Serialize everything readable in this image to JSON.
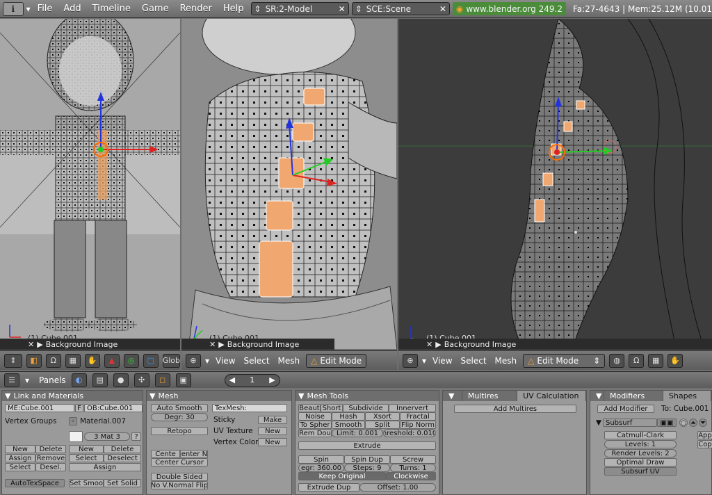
{
  "topbar": {
    "menus": [
      "File",
      "Add",
      "Timeline",
      "Game",
      "Render",
      "Help"
    ],
    "screen": "SR:2-Model",
    "scene": "SCE:Scene",
    "version_link": "www.blender.org 249.2",
    "stats": "Fa:27-4643 | Mem:25.12M (10.01"
  },
  "viewports": {
    "left": {
      "object_label": "(1) Cube.001",
      "bg_label": "Background Image"
    },
    "middle": {
      "object_label": "(1) Cube.001",
      "bg_label": "Background Image"
    },
    "right": {
      "object_label": "(1) Cube.001",
      "bg_label": "Background Image"
    }
  },
  "headers": {
    "left": {
      "glob": "Glob"
    },
    "middle": {
      "menus": [
        "View",
        "Select",
        "Mesh"
      ],
      "mode": "Edit Mode"
    },
    "right": {
      "menus": [
        "View",
        "Select",
        "Mesh"
      ],
      "mode": "Edit Mode"
    }
  },
  "buttons_window": {
    "label": "Panels",
    "page": "1"
  },
  "link_materials": {
    "title": "Link and Materials",
    "me_field": "ME:Cube.001",
    "f_label": "F",
    "ob_field": "OB:Cube.001",
    "vertex_groups": "Vertex Groups",
    "material_name": "Material.007",
    "mat_index": "3 Mat 3",
    "q": "?",
    "vg_buttons": {
      "new": "New",
      "delete": "Delete",
      "assign": "Assign",
      "remove": "Remove",
      "select": "Select",
      "desel": "Desel."
    },
    "mat_buttons": {
      "new": "New",
      "delete": "Delete",
      "select": "Select",
      "deselect": "Deselect",
      "assign": "Assign"
    },
    "autotexspace": "AutoTexSpace",
    "set_smooth": "Set Smoo",
    "set_solid": "Set Solid"
  },
  "mesh": {
    "title": "Mesh",
    "auto_smooth": "Auto Smooth",
    "degr": "Degr: 30",
    "retopo": "Retopo",
    "texmesh": "TexMesh:",
    "sticky": "Sticky",
    "make": "Make",
    "uv_texture": "UV Texture",
    "new1": "New",
    "vertex_color": "Vertex Color",
    "new2": "New",
    "center": "Cente",
    "center_new": "Center Ne",
    "center_cursor": "Center Cursor",
    "double_sided": "Double Sided",
    "no_vnormal_flip": "No V.Normal Flip"
  },
  "mesh_tools": {
    "title": "Mesh Tools",
    "beaut": "Beaut",
    "short": "Short",
    "subdivide": "Subdivide",
    "innervert": "Innervert",
    "noise": "Noise",
    "hash": "Hash",
    "xsort": "Xsort",
    "fractal": "Fractal",
    "to_sphere": "To Spher",
    "smooth": "Smooth",
    "split": "Split",
    "flip_normals": "Flip Norm",
    "rem_doubles": "Rem Dou",
    "limit": "Limit: 0.001",
    "threshold": "hreshold: 0.010",
    "extrude": "Extrude",
    "spin": "Spin",
    "spin_dup": "Spin Dup",
    "screw": "Screw",
    "degr": "egr: 360.00",
    "steps": "Steps: 9",
    "turns": "Turns: 1",
    "keep_original": "Keep Original",
    "clockwise": "Clockwise",
    "extrude_dup": "Extrude Dup",
    "offset": "Offset: 1.00"
  },
  "multires": {
    "tab_multires": "Multires",
    "tab_uv": "UV Calculation",
    "add_multires": "Add Multires"
  },
  "modifiers": {
    "tab_modifiers": "Modifiers",
    "tab_shapes": "Shapes",
    "add_modifier": "Add Modifier",
    "to": "To: Cube.001",
    "subsurf": "Subsurf",
    "catmull": "Catmull-Clark",
    "levels": "Levels: 1",
    "render_levels": "Render Levels: 2",
    "optimal_draw": "Optimal Draw",
    "subsurf_uv": "Subsurf UV",
    "apply": "App",
    "copy": "Cop"
  }
}
